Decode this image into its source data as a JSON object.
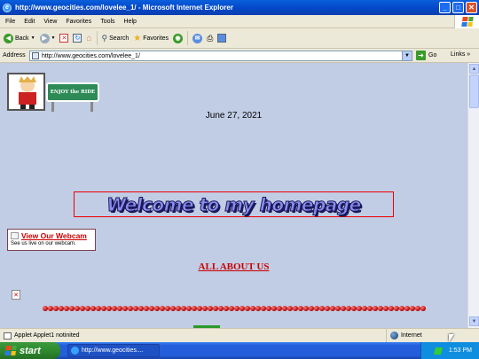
{
  "window": {
    "title": "http://www.geocities.com/lovelee_1/ - Microsoft Internet Explorer",
    "min_label": "_",
    "max_label": "□",
    "close_label": "✕"
  },
  "menu": {
    "items": [
      "File",
      "Edit",
      "View",
      "Favorites",
      "Tools",
      "Help"
    ]
  },
  "toolbar": {
    "back_label": "Back",
    "search_label": "Search",
    "favorites_label": "Favorites"
  },
  "address": {
    "label": "Address",
    "url": "http://www.geocities.com/lovelee_1/",
    "go_label": "Go",
    "links_label": "Links"
  },
  "page": {
    "sign_text": "ENJOY the RIDE",
    "date": "June 27, 2021",
    "welcome": "Welcome to my homepage",
    "webcam_link": "View Our Webcam",
    "webcam_sub": "See us live on our webcam.",
    "about_link": "ALL ABOUT US",
    "broken_image_icon": "✕",
    "colors": {
      "background": "#c1cde4",
      "link_red": "#cc0000",
      "welcome_fill": "#8c8cf0"
    }
  },
  "status": {
    "text": "Applet Applet1 notinited",
    "zone": "Internet"
  },
  "taskbar": {
    "start_label": "start",
    "task_label": "http://www.geocities....",
    "clock": "1:53 PM"
  }
}
